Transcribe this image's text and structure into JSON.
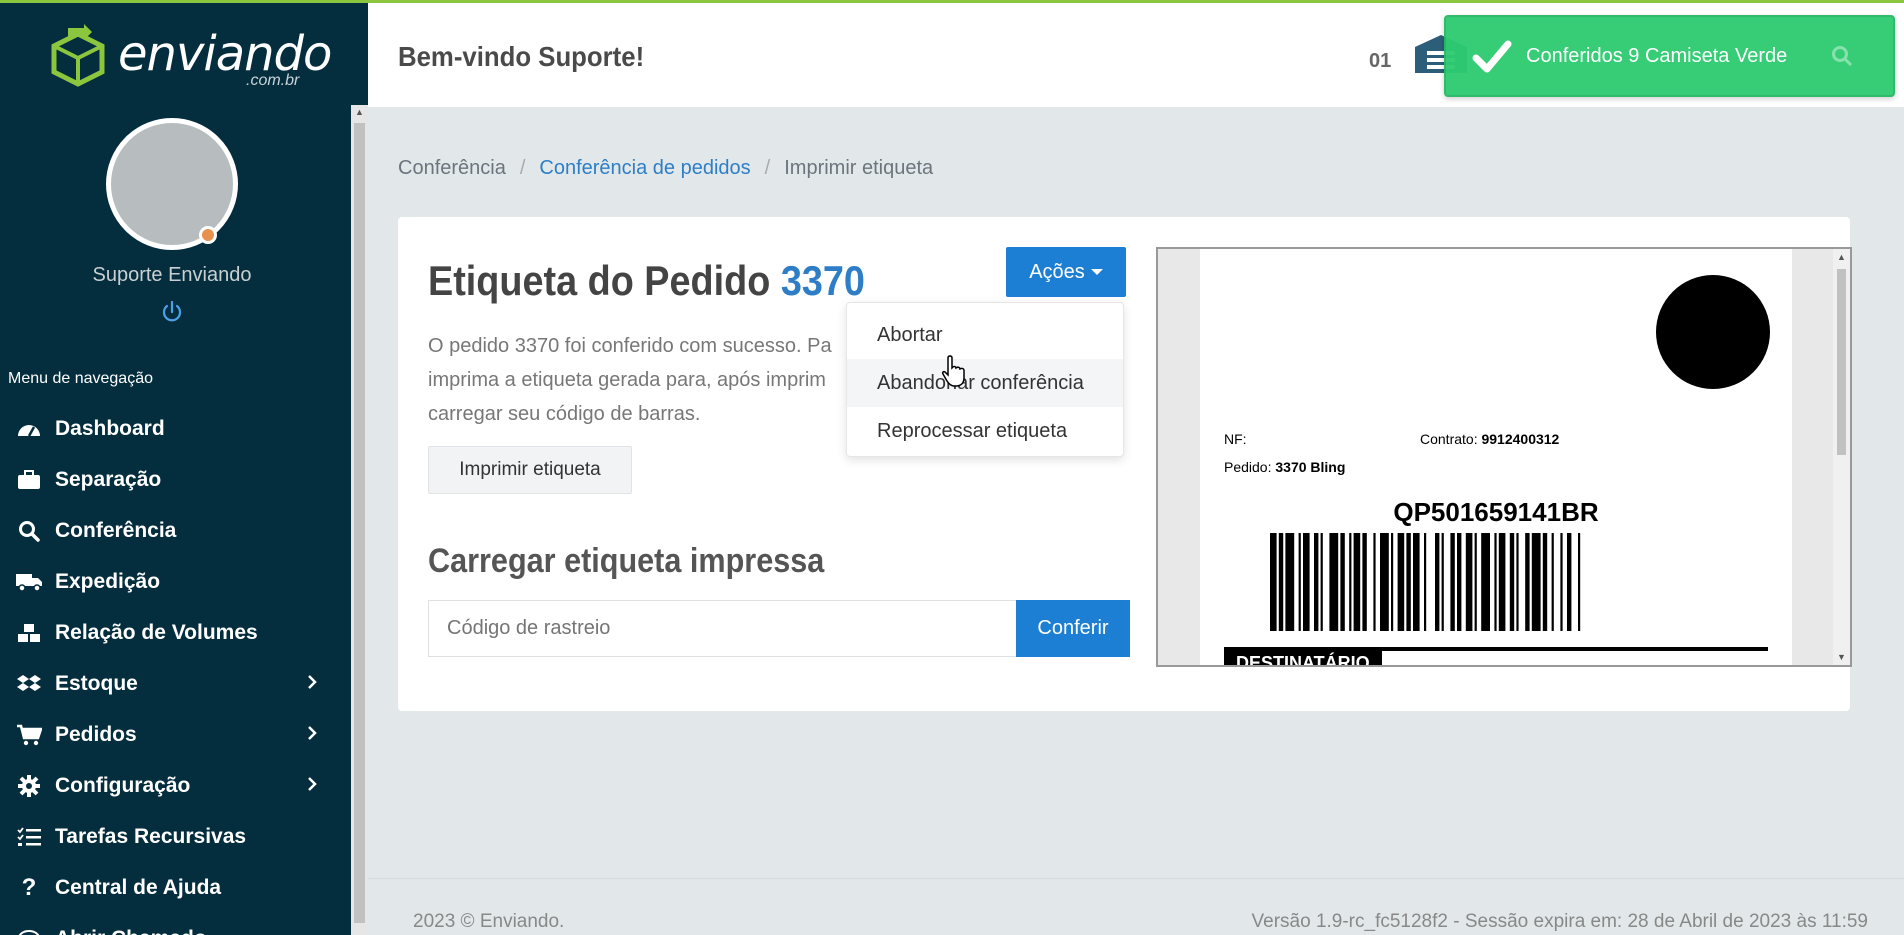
{
  "brand": {
    "name": "enviando",
    "suffix": ".com.br"
  },
  "user": {
    "name": "Suporte Enviando"
  },
  "nav": {
    "title": "Menu de navegação",
    "items": [
      {
        "label": "Dashboard",
        "icon": "dashboard-icon"
      },
      {
        "label": "Separação",
        "icon": "briefcase-icon"
      },
      {
        "label": "Conferência",
        "icon": "search-icon"
      },
      {
        "label": "Expedição",
        "icon": "truck-icon"
      },
      {
        "label": "Relação de Volumes",
        "icon": "boxes-icon"
      },
      {
        "label": "Estoque",
        "icon": "dropbox-icon"
      },
      {
        "label": "Pedidos",
        "icon": "cart-icon"
      },
      {
        "label": "Configuração",
        "icon": "gear-icon"
      },
      {
        "label": "Tarefas Recursivas",
        "icon": "tasks-icon"
      },
      {
        "label": "Central de Ajuda",
        "icon": "question-icon"
      },
      {
        "label": "Abrir Chamado",
        "icon": "chat-icon"
      }
    ]
  },
  "header": {
    "welcome": "Bem-vindo Suporte!",
    "count": "01"
  },
  "toast": {
    "message": "Conferidos 9 Camiseta Verde"
  },
  "breadcrumb": {
    "item1": "Conferência",
    "item2": "Conferência de pedidos",
    "item3": "Imprimir etiqueta"
  },
  "card": {
    "title_prefix": "Etiqueta do Pedido ",
    "order_number": "3370",
    "line1": "O pedido 3370 foi conferido com sucesso. Pa",
    "line2": "imprima a etiqueta gerada para, após imprim",
    "line3": "carregar seu código de barras.",
    "print_button": "Imprimir etiqueta",
    "subtitle": "Carregar etiqueta impressa",
    "tracking_placeholder": "Código de rastreio",
    "check_button": "Conferir",
    "actions_button": "Ações",
    "dropdown": [
      "Abortar",
      "Abandonar conferência",
      "Reprocessar etiqueta"
    ]
  },
  "label": {
    "nf_label": "NF:",
    "contract_label": "Contrato:",
    "contract_value": "9912400312",
    "order_label": "Pedido:",
    "order_value": "3370 Bling",
    "tracking": "QP501659141BR",
    "recipient": "DESTINATÁRIO"
  },
  "footer": {
    "copyright": "2023 © Enviando.",
    "version": "Versão 1.9-rc_fc5128f2 - Sessão expira em: 28 de Abril de 2023 às 11:59"
  },
  "colors": {
    "sidebar": "#042d3d",
    "accent": "#1d7fd4",
    "toast": "#2ecc71",
    "brand_green": "#8cc63f"
  }
}
